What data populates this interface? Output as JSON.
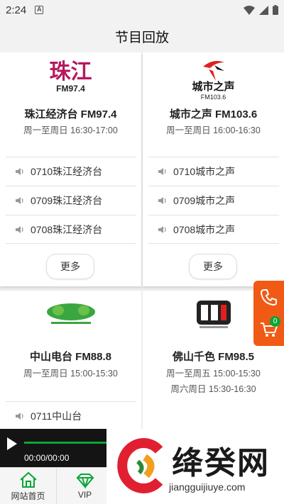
{
  "status": {
    "time": "2:24",
    "notif_icon": "A"
  },
  "header": {
    "title": "节目回放"
  },
  "stations": [
    {
      "logo_text": "珠江",
      "logo_sub": "FM97.4",
      "name": "珠江经济台 FM97.4",
      "time1": "周一至周日 16:30-17:00",
      "episodes": [
        "0710珠江经济台",
        "0709珠江经济台",
        "0708珠江经济台"
      ],
      "more": "更多"
    },
    {
      "logo_text": "城市之声",
      "logo_sub": "FM103.6",
      "name": "城市之声 FM103.6",
      "time1": "周一至周日 16:00-16:30",
      "episodes": [
        "0710城市之声",
        "0709城市之声",
        "0708城市之声"
      ],
      "more": "更多"
    },
    {
      "name": "中山电台 FM88.8",
      "time1": "周一至周日 15:00-15:30",
      "episodes": [
        "0711中山台"
      ]
    },
    {
      "name": "佛山千色 FM98.5",
      "time1": "周一至周五 15:00-15:30",
      "time2": "周六周日 15:30-16:30"
    }
  ],
  "float": {
    "cart_count": "0"
  },
  "player": {
    "time": "00:00/00:00"
  },
  "nav": {
    "home": "网站首页",
    "vip": "VIP"
  },
  "watermark": {
    "text": "绛癸网",
    "url": "jiangguijiuye.com"
  },
  "colors": {
    "accent": "#0aa536",
    "float": "#f05a14"
  }
}
